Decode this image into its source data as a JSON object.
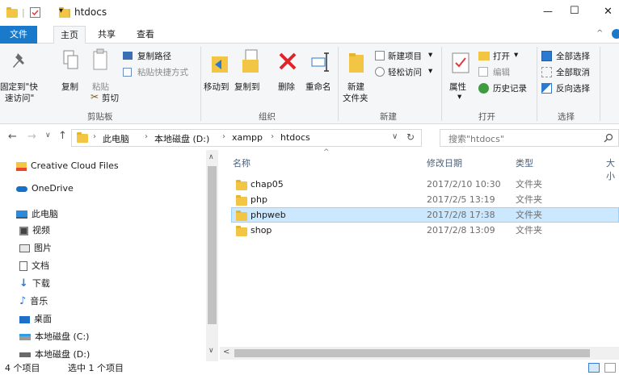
{
  "window": {
    "title": "htdocs",
    "controls": {
      "minimize": "—",
      "maximize": "☐",
      "close": "✕"
    }
  },
  "tabs": {
    "file": "文件",
    "home": "主页",
    "share": "共享",
    "view": "查看"
  },
  "ribbon": {
    "clipboard": {
      "pin_line1": "固定到\"快",
      "pin_line2": "速访问\"",
      "copy": "复制",
      "paste": "粘贴",
      "copy_path": "复制路径",
      "paste_shortcut": "粘贴快捷方式",
      "cut": "剪切",
      "label": "剪贴板"
    },
    "organize": {
      "move_to": "移动到",
      "copy_to": "复制到",
      "delete": "删除",
      "rename": "重命名",
      "label": "组织"
    },
    "new": {
      "new_folder_line1": "新建",
      "new_folder_line2": "文件夹",
      "new_item": "新建项目",
      "easy_access": "轻松访问",
      "label": "新建"
    },
    "open": {
      "properties": "属性",
      "open": "打开",
      "edit": "编辑",
      "history": "历史记录",
      "label": "打开"
    },
    "select": {
      "select_all": "全部选择",
      "select_none": "全部取消",
      "invert": "反向选择",
      "label": "选择"
    }
  },
  "address": {
    "crumbs": [
      "此电脑",
      "本地磁盘 (D:)",
      "xampp",
      "htdocs"
    ],
    "search_placeholder": "搜索\"htdocs\""
  },
  "nav": {
    "items": [
      "Creative Cloud Files",
      "OneDrive",
      "此电脑",
      "视频",
      "图片",
      "文档",
      "下载",
      "音乐",
      "桌面",
      "本地磁盘 (C:)",
      "本地磁盘 (D:)"
    ]
  },
  "columns": {
    "name": "名称",
    "date": "修改日期",
    "type": "类型",
    "size": "大小"
  },
  "files": [
    {
      "name": "chap05",
      "date": "2017/2/10 10:30",
      "type": "文件夹"
    },
    {
      "name": "php",
      "date": "2017/2/5 13:19",
      "type": "文件夹"
    },
    {
      "name": "phpweb",
      "date": "2017/2/8 17:38",
      "type": "文件夹"
    },
    {
      "name": "shop",
      "date": "2017/2/8 13:09",
      "type": "文件夹"
    }
  ],
  "status": {
    "count": "4 个项目",
    "selected": "选中 1 个项目"
  },
  "colors": {
    "accent": "#1979ca",
    "selection": "#cce8ff",
    "folder": "#f2c644"
  }
}
